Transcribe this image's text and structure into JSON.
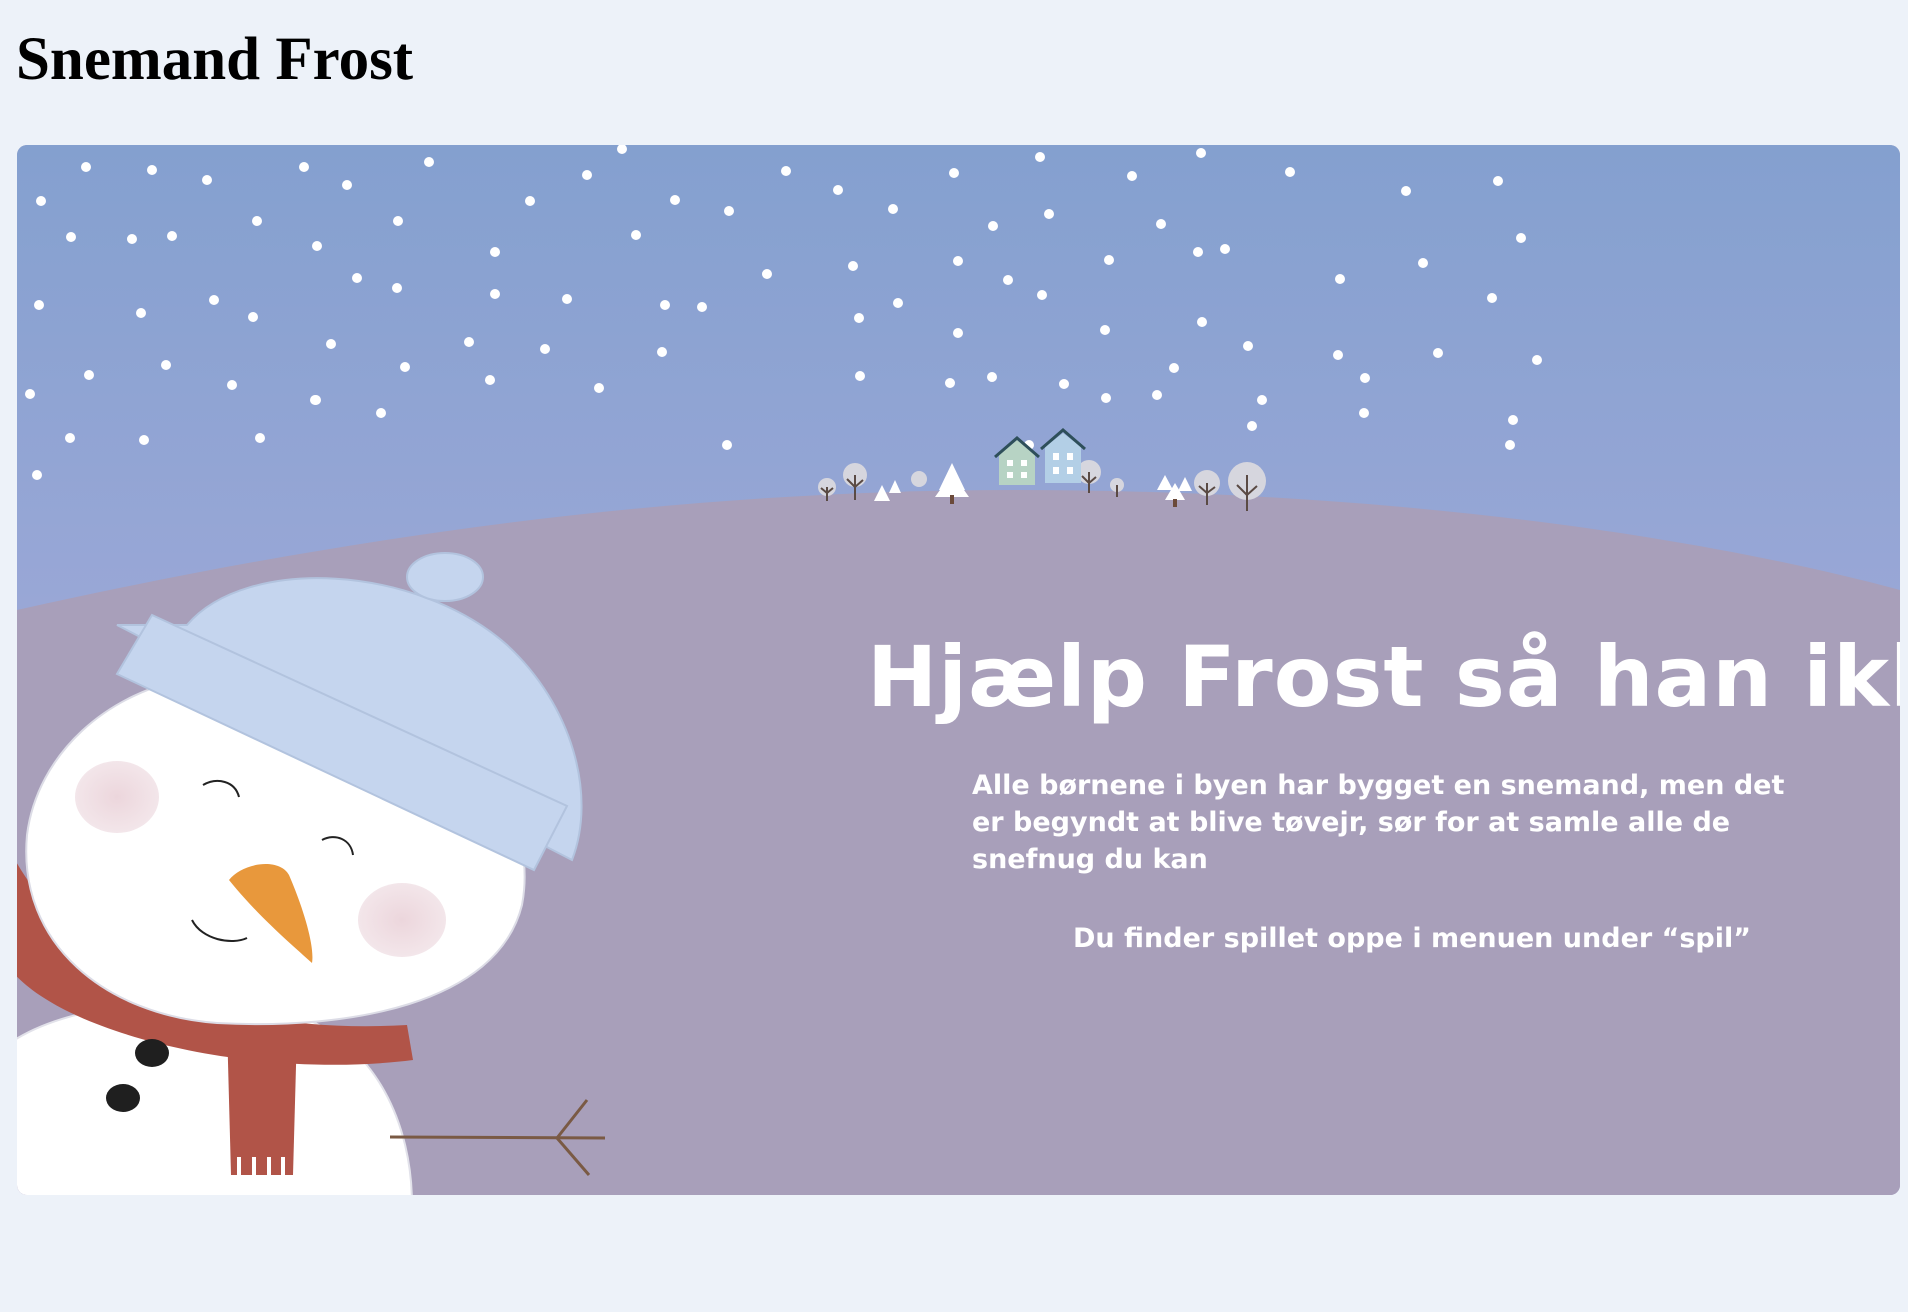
{
  "page": {
    "title": "Snemand Frost"
  },
  "scene": {
    "heading": "Hjælp Frost så han ikke tør",
    "paragraph": "Alle børnene i byen har bygget en snemand, men det er begyndt at blive tøvejr, sør for at samle alle de snefnug du kan",
    "hint": "Du finder spillet oppe i menuen under “spil”",
    "colors": {
      "sky_top": "#84a0cf",
      "sky_bottom": "#b4b0e0",
      "hill": "#a89fba",
      "snowflake": "#ffffff",
      "snowman_body": "#ffffff",
      "hat": "#c5d5ee",
      "scarf": "#b15448",
      "carrot_nose": "#e8983c",
      "cheeks": "#ecd6dc",
      "text": "#ffffff"
    },
    "illustration": {
      "snowman": "snowman-with-hat-and-scarf",
      "village": "village-houses-and-trees",
      "snowflakes": "falling-snow"
    }
  }
}
